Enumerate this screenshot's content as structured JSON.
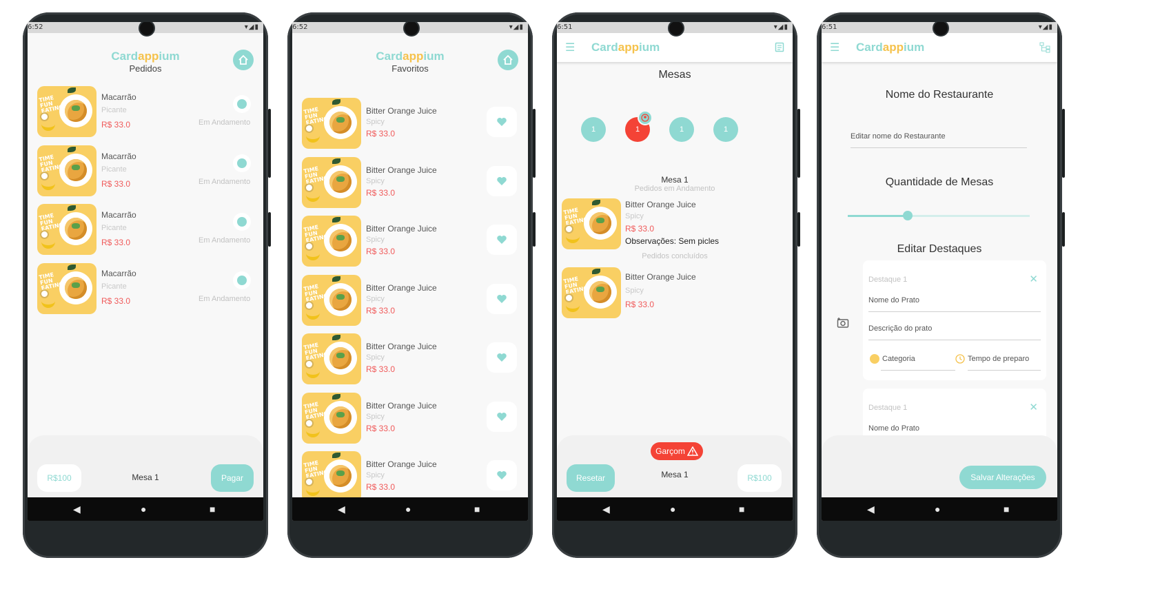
{
  "brand": {
    "part1": "Card",
    "part2": "app",
    "part3": "ium"
  },
  "screens": {
    "pedidos": {
      "status_time": "6:52",
      "subtitle": "Pedidos",
      "items": [
        {
          "name": "Macarrão",
          "desc": "Picante",
          "price": "R$ 33.0",
          "status": "Em Andamento"
        },
        {
          "name": "Macarrão",
          "desc": "Picante",
          "price": "R$ 33.0",
          "status": "Em Andamento"
        },
        {
          "name": "Macarrão",
          "desc": "Picante",
          "price": "R$ 33.0",
          "status": "Em Andamento"
        },
        {
          "name": "Macarrão",
          "desc": "Picante",
          "price": "R$ 33.0",
          "status": "Em Andamento"
        }
      ],
      "total": "R$100",
      "table": "Mesa 1",
      "pay": "Pagar"
    },
    "favoritos": {
      "status_time": "6:52",
      "subtitle": "Favoritos",
      "items": [
        {
          "name": "Bitter Orange Juice",
          "desc": "Spicy",
          "price": "R$ 33.0"
        },
        {
          "name": "Bitter Orange Juice",
          "desc": "Spicy",
          "price": "R$ 33.0"
        },
        {
          "name": "Bitter Orange Juice",
          "desc": "Spicy",
          "price": "R$ 33.0"
        },
        {
          "name": "Bitter Orange Juice",
          "desc": "Spicy",
          "price": "R$ 33.0"
        },
        {
          "name": "Bitter Orange Juice",
          "desc": "Spicy",
          "price": "R$ 33.0"
        },
        {
          "name": "Bitter Orange Juice",
          "desc": "Spicy",
          "price": "R$ 33.0"
        },
        {
          "name": "Bitter Orange Juice",
          "desc": "Spicy",
          "price": "R$ 33.0"
        }
      ]
    },
    "mesas": {
      "status_time": "6:51",
      "title": "Mesas",
      "tables": [
        "1",
        "1",
        "1",
        "1"
      ],
      "selected_title": "Mesa 1",
      "in_progress_label": "Pedidos em Andamento",
      "order1": {
        "name": "Bitter Orange Juice",
        "desc": "Spicy",
        "price": "R$ 33.0",
        "obs": "Observações: Sem picles"
      },
      "done_label": "Pedidos concluídos",
      "order2": {
        "name": "Bitter Orange Juice",
        "desc": "Spicy",
        "price": "R$ 33.0"
      },
      "waiter": "Garçom",
      "reset": "Resetar",
      "table": "Mesa 1",
      "total": "R$100"
    },
    "config": {
      "status_time": "6:51",
      "restaurant_title": "Nome do Restaurante",
      "restaurant_placeholder": "Editar nome do Restaurante",
      "tables_title": "Quantidade de Mesas",
      "slider_value": 0.33,
      "highlights_title": "Editar Destaques",
      "card1": {
        "label": "Destaque 1",
        "dish": "Nome do Prato",
        "desc": "Descrição do prato",
        "category": "Categoria",
        "prep": "Tempo de preparo"
      },
      "card2": {
        "label": "Destaque 1",
        "dish": "Nome do Prato"
      },
      "save": "Salvar Alterações"
    }
  },
  "colors": {
    "teal": "#8fd9d2",
    "yellow": "#f5c24c",
    "red": "#f44336",
    "price": "#f05a5a"
  }
}
